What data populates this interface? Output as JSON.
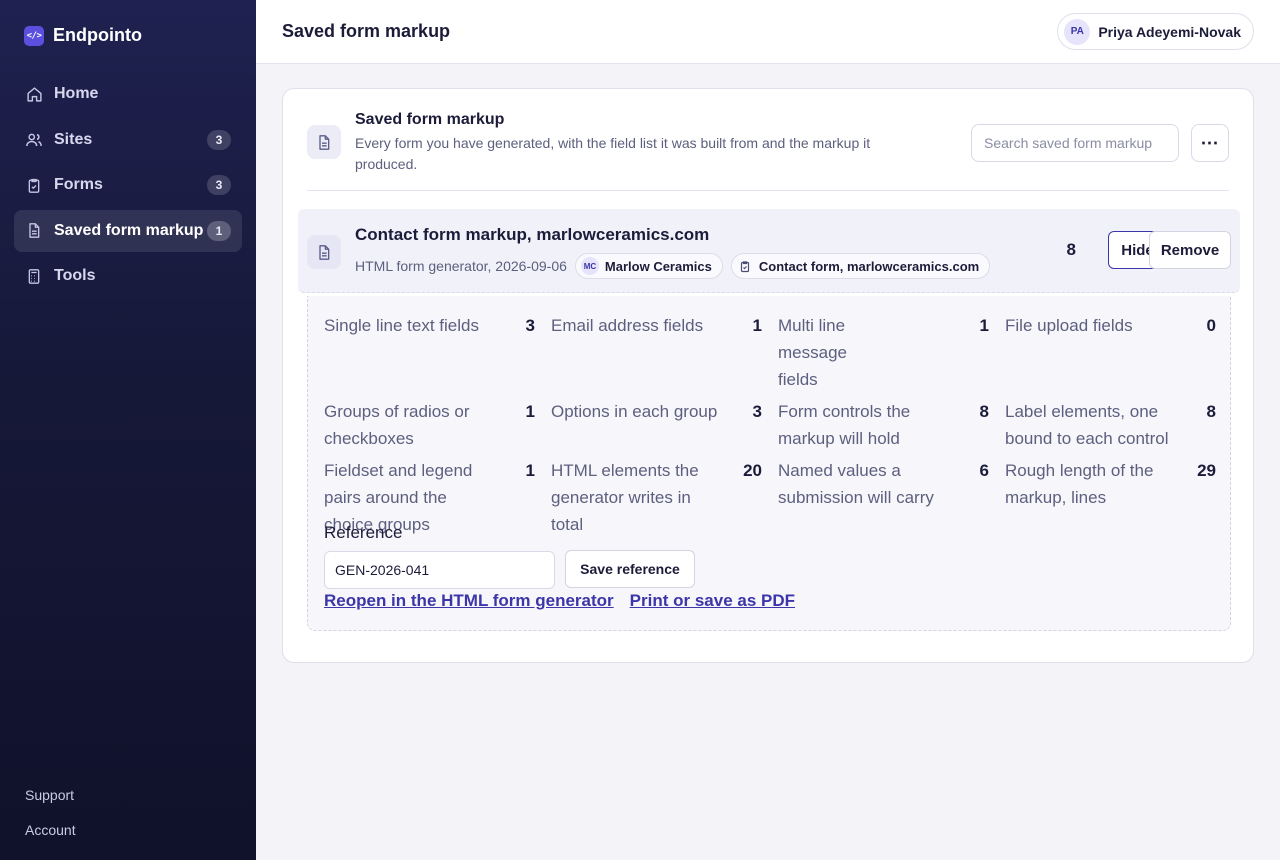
{
  "brand": {
    "name": "Endpointo",
    "logo_glyph": "</>"
  },
  "sidebar": {
    "items": [
      {
        "label": "Home",
        "icon": "home-icon",
        "count": null
      },
      {
        "label": "Sites",
        "icon": "users-icon",
        "count": "3"
      },
      {
        "label": "Forms",
        "icon": "clipboard-icon",
        "count": "3"
      },
      {
        "label": "Saved form markup",
        "icon": "document-icon",
        "count": "1",
        "active": true
      },
      {
        "label": "Tools",
        "icon": "calculator-icon",
        "count": null
      }
    ],
    "footer": {
      "support": "Support",
      "account": "Account"
    }
  },
  "header": {
    "title": "Saved form markup",
    "user": {
      "initials": "PA",
      "name": "Priya Adeyemi-Novak"
    }
  },
  "panel": {
    "title": "Saved form markup",
    "description": "Every form you have generated, with the field list it was built from and the markup it produced.",
    "search_placeholder": "Search saved form markup",
    "more_label": "⋯"
  },
  "record": {
    "title": "Contact form markup, marlowceramics.com",
    "meta": "HTML form generator, 2026-09-06",
    "site_pill": {
      "initials": "MC",
      "label": "Marlow Ceramics"
    },
    "form_pill": {
      "label": "Contact form, marlowceramics.com"
    },
    "count": "8",
    "hide_label": "Hide",
    "remove_label": "Remove"
  },
  "stats": [
    {
      "label": "Single line text fields",
      "value": "3"
    },
    {
      "label": "Email address fields",
      "value": "1"
    },
    {
      "label": "Multi line message fields",
      "value": "1"
    },
    {
      "label": "File upload fields",
      "value": "0"
    },
    {
      "label": "Groups of radios or checkboxes",
      "value": "1"
    },
    {
      "label": "Options in each group",
      "value": "3"
    },
    {
      "label": "Form controls the markup will hold",
      "value": "8"
    },
    {
      "label": "Label elements, one bound to each control",
      "value": "8"
    },
    {
      "label": "Fieldset and legend pairs around the choice groups",
      "value": "1"
    },
    {
      "label": "HTML elements the generator writes in total",
      "value": "20"
    },
    {
      "label": "Named values a submission will carry",
      "value": "6"
    },
    {
      "label": "Rough length of the markup, lines",
      "value": "29"
    }
  ],
  "reference": {
    "label": "Reference",
    "value": "GEN-2026-041",
    "save_label": "Save reference"
  },
  "links": {
    "reopen": "Reopen in the HTML form generator",
    "print": "Print or save as PDF"
  }
}
